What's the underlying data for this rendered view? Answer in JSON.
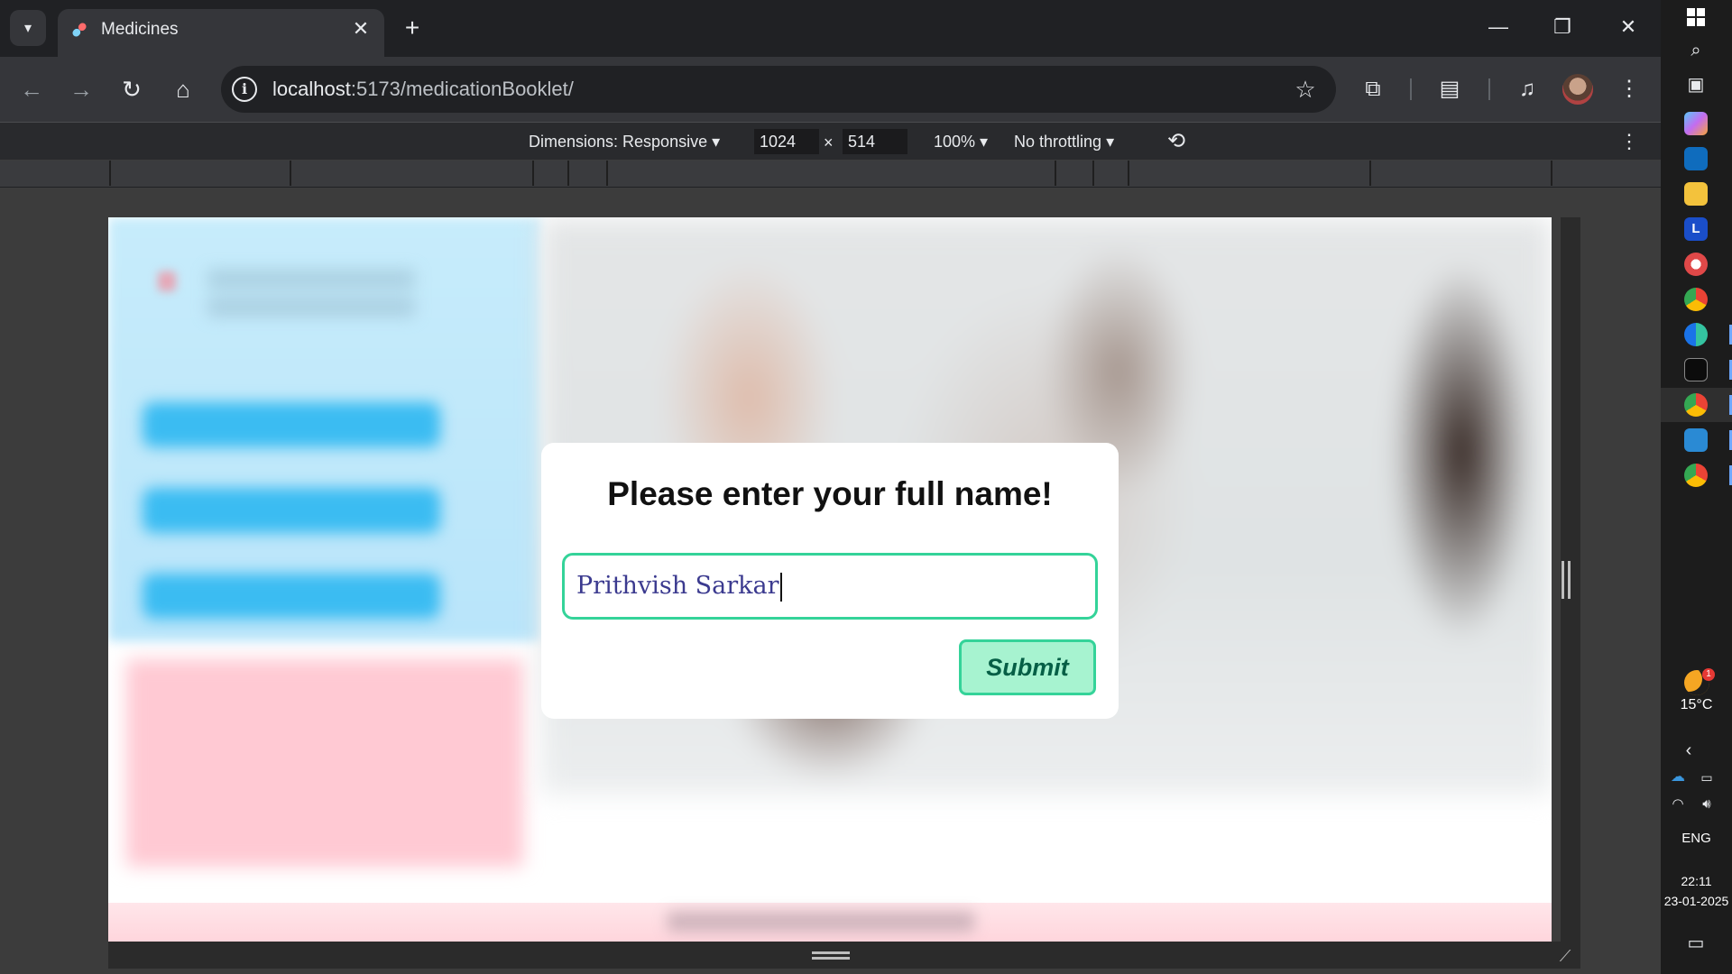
{
  "browser": {
    "tab": {
      "title": "Medicines",
      "favicon": "pill-icon"
    },
    "omnibox": {
      "url_host": "localhost",
      "url_path": ":5173/medicationBooklet/"
    }
  },
  "devtools": {
    "dimensions_label": "Dimensions: Responsive",
    "width": "1024",
    "height": "514",
    "times": "×",
    "zoom": "100%",
    "throttling": "No throttling"
  },
  "modal": {
    "title": "Please enter your full name!",
    "input_value": "Prithvish Sarkar",
    "submit_label": "Submit"
  },
  "taskbar": {
    "weather_temp": "15°C",
    "weather_badge": "1",
    "language": "ENG",
    "time": "22:11",
    "date": "23-01-2025"
  },
  "colors": {
    "input_border": "#34d399",
    "submit_bg": "#a7f3d0",
    "submit_text": "#065f46",
    "input_text": "#3b3a8f"
  }
}
